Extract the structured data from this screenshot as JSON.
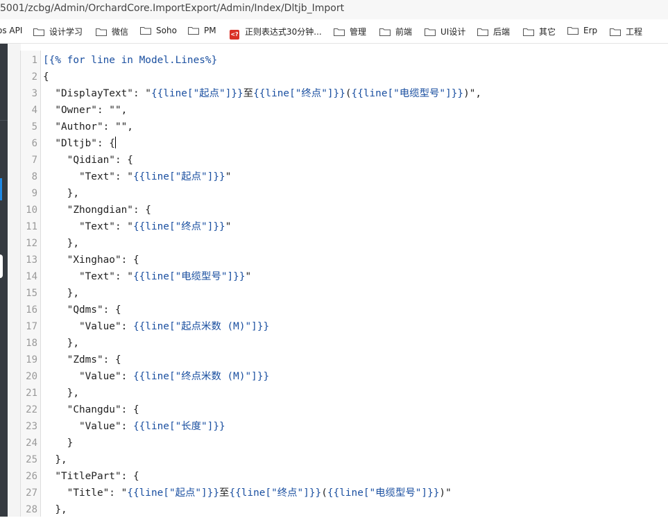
{
  "browser": {
    "url": "5001/zcbg/Admin/OrchardCore.ImportExport/Admin/Index/Dltjb_Import"
  },
  "bookmarks": [
    {
      "label": "os API",
      "icon": "none"
    },
    {
      "label": "设计学习",
      "icon": "folder-icon"
    },
    {
      "label": "微信",
      "icon": "folder-icon"
    },
    {
      "label": "Soho",
      "icon": "folder-icon"
    },
    {
      "label": "PM",
      "icon": "folder-icon"
    },
    {
      "label": "正则表达式30分钟...",
      "icon": "regex-icon",
      "icon_text": "<?"
    },
    {
      "label": "管理",
      "icon": "folder-icon"
    },
    {
      "label": "前端",
      "icon": "folder-icon"
    },
    {
      "label": "UI设计",
      "icon": "folder-icon"
    },
    {
      "label": "后端",
      "icon": "folder-icon"
    },
    {
      "label": "其它",
      "icon": "folder-icon"
    },
    {
      "label": "Erp",
      "icon": "folder-icon"
    },
    {
      "label": "工程",
      "icon": "folder-icon"
    }
  ],
  "editor": {
    "lines": [
      {
        "n": "1",
        "indent": "",
        "parts": [
          [
            "[{% for line in Model.Lines%}",
            "k"
          ]
        ]
      },
      {
        "n": "2",
        "indent": "",
        "parts": [
          [
            "{",
            "s"
          ]
        ]
      },
      {
        "n": "3",
        "indent": "  ",
        "parts": [
          [
            "\"DisplayText\": \"",
            "s"
          ],
          [
            "{{line[\"起点\"]}}",
            "b"
          ],
          [
            "至",
            "s"
          ],
          [
            "{{line[\"终点\"]}}",
            "b"
          ],
          [
            "(",
            "s"
          ],
          [
            "{{line[\"电缆型号\"]}}",
            "b"
          ],
          [
            ")\",",
            "s"
          ]
        ]
      },
      {
        "n": "4",
        "indent": "  ",
        "parts": [
          [
            "\"Owner\": \"\",",
            "s"
          ]
        ]
      },
      {
        "n": "5",
        "indent": "  ",
        "parts": [
          [
            "\"Author\": \"\",",
            "s"
          ]
        ]
      },
      {
        "n": "6",
        "indent": "  ",
        "parts": [
          [
            "\"Dltjb\": {",
            "s"
          ]
        ],
        "caret": true
      },
      {
        "n": "7",
        "indent": "    ",
        "parts": [
          [
            "\"Qidian\": {",
            "s"
          ]
        ]
      },
      {
        "n": "8",
        "indent": "      ",
        "parts": [
          [
            "\"Text\": \"",
            "s"
          ],
          [
            "{{line[\"起点\"]}}",
            "b"
          ],
          [
            "\"",
            "s"
          ]
        ]
      },
      {
        "n": "9",
        "indent": "    ",
        "parts": [
          [
            "},",
            "s"
          ]
        ]
      },
      {
        "n": "10",
        "indent": "    ",
        "parts": [
          [
            "\"Zhongdian\": {",
            "s"
          ]
        ]
      },
      {
        "n": "11",
        "indent": "      ",
        "parts": [
          [
            "\"Text\": \"",
            "s"
          ],
          [
            "{{line[\"终点\"]}}",
            "b"
          ],
          [
            "\"",
            "s"
          ]
        ]
      },
      {
        "n": "12",
        "indent": "    ",
        "parts": [
          [
            "},",
            "s"
          ]
        ]
      },
      {
        "n": "13",
        "indent": "    ",
        "parts": [
          [
            "\"Xinghao\": {",
            "s"
          ]
        ]
      },
      {
        "n": "14",
        "indent": "      ",
        "parts": [
          [
            "\"Text\": \"",
            "s"
          ],
          [
            "{{line[\"电缆型号\"]}}",
            "b"
          ],
          [
            "\"",
            "s"
          ]
        ]
      },
      {
        "n": "15",
        "indent": "    ",
        "parts": [
          [
            "},",
            "s"
          ]
        ]
      },
      {
        "n": "16",
        "indent": "    ",
        "parts": [
          [
            "\"Qdms\": {",
            "s"
          ]
        ]
      },
      {
        "n": "17",
        "indent": "      ",
        "parts": [
          [
            "\"Value\": ",
            "s"
          ],
          [
            "{{line[\"起点米数 (M)\"]}}",
            "b"
          ]
        ]
      },
      {
        "n": "18",
        "indent": "    ",
        "parts": [
          [
            "},",
            "s"
          ]
        ]
      },
      {
        "n": "19",
        "indent": "    ",
        "parts": [
          [
            "\"Zdms\": {",
            "s"
          ]
        ]
      },
      {
        "n": "20",
        "indent": "      ",
        "parts": [
          [
            "\"Value\": ",
            "s"
          ],
          [
            "{{line[\"终点米数 (M)\"]}}",
            "b"
          ]
        ]
      },
      {
        "n": "21",
        "indent": "    ",
        "parts": [
          [
            "},",
            "s"
          ]
        ]
      },
      {
        "n": "22",
        "indent": "    ",
        "parts": [
          [
            "\"Changdu\": {",
            "s"
          ]
        ]
      },
      {
        "n": "23",
        "indent": "      ",
        "parts": [
          [
            "\"Value\": ",
            "s"
          ],
          [
            "{{line[\"长度\"]}}",
            "b"
          ]
        ]
      },
      {
        "n": "24",
        "indent": "    ",
        "parts": [
          [
            "}",
            "s"
          ]
        ]
      },
      {
        "n": "25",
        "indent": "  ",
        "parts": [
          [
            "},",
            "s"
          ]
        ]
      },
      {
        "n": "26",
        "indent": "  ",
        "parts": [
          [
            "\"TitlePart\": {",
            "s"
          ]
        ]
      },
      {
        "n": "27",
        "indent": "    ",
        "parts": [
          [
            "\"Title\": \"",
            "s"
          ],
          [
            "{{line[\"起点\"]}}",
            "b"
          ],
          [
            "至",
            "s"
          ],
          [
            "{{line[\"终点\"]}}",
            "b"
          ],
          [
            "(",
            "s"
          ],
          [
            "{{line[\"电缆型号\"]}}",
            "b"
          ],
          [
            ")\"",
            "s"
          ]
        ]
      },
      {
        "n": "28",
        "indent": "  ",
        "parts": [
          [
            "},",
            "s"
          ]
        ]
      }
    ]
  }
}
